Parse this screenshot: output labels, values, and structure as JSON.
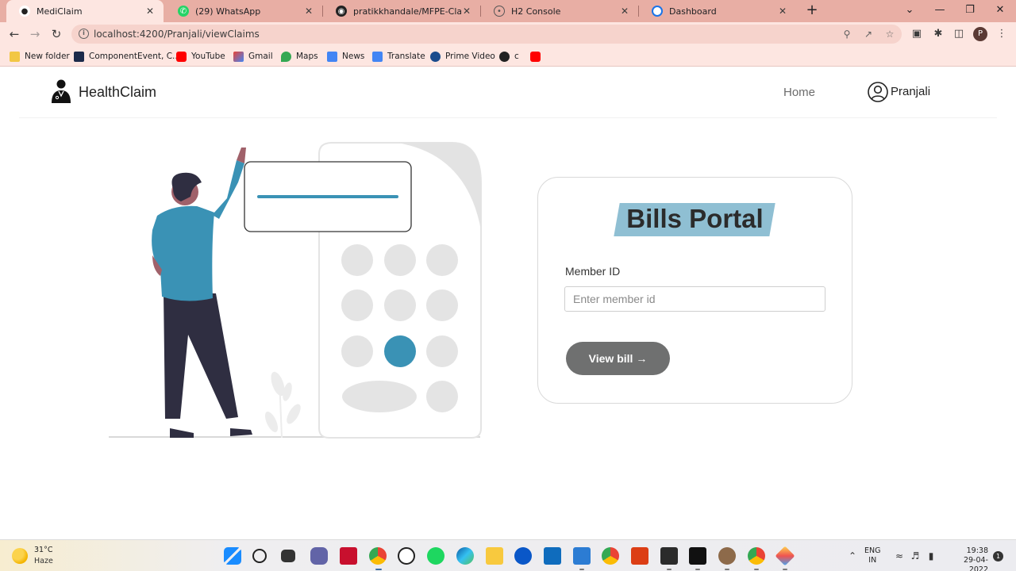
{
  "browser": {
    "tabs": [
      {
        "title": "MediClaim",
        "icon": "medical-person-icon",
        "active": true
      },
      {
        "title": "(29) WhatsApp",
        "icon": "whatsapp-icon",
        "active": false
      },
      {
        "title": "pratikkhandale/MFPE-Claim-Man",
        "icon": "github-icon",
        "active": false
      },
      {
        "title": "H2 Console",
        "icon": "globe-icon",
        "active": false
      },
      {
        "title": "Dashboard",
        "icon": "edge-icon",
        "active": false
      }
    ],
    "url": "localhost:4200/Pranjali/viewClaims",
    "profile_initial": "P",
    "bookmarks": [
      "New folder",
      "ComponentEvent, C...",
      "YouTube",
      "Gmail",
      "Maps",
      "News",
      "Translate",
      "Prime Video",
      "c",
      ""
    ]
  },
  "header": {
    "brand": "HealthClaim",
    "nav_home": "Home",
    "user_name": "Pranjali"
  },
  "card": {
    "title": "Bills Portal",
    "member_label": "Member ID",
    "member_placeholder": "Enter member id",
    "member_value": "",
    "button_label": "View bill →"
  },
  "taskbar": {
    "temperature": "31°C",
    "weather": "Haze",
    "language": "ENG",
    "region": "IN",
    "time": "19:38",
    "date": "29-04-2022",
    "notifications": "1"
  },
  "colors": {
    "accent": "#3a92b5",
    "title_highlight": "#8fbfd3",
    "button": "#6f7070",
    "tab_strip": "#e8aea4",
    "toolbar": "#fde6e1"
  }
}
